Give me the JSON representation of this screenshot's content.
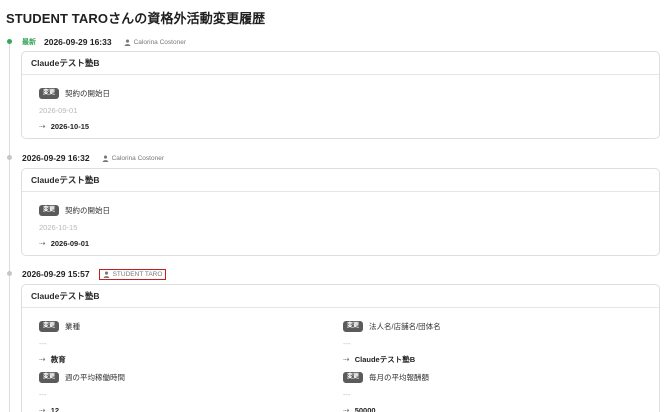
{
  "page": {
    "title": "STUDENT TAROさんの資格外活動変更履歴"
  },
  "common": {
    "latest_badge": "最新",
    "change_tag": "変更",
    "arrow": "⇢"
  },
  "entries": [
    {
      "timestamp": "2026-09-29 16:33",
      "user": "Calorina Costoner",
      "card_title": "Claudeテスト塾B",
      "changes": [
        {
          "field": "契約の開始日",
          "old": "2026-09-01",
          "new": "2026-10-15"
        }
      ]
    },
    {
      "timestamp": "2026-09-29 16:32",
      "user": "Calorina Costoner",
      "card_title": "Claudeテスト塾B",
      "changes": [
        {
          "field": "契約の開始日",
          "old": "2026-10-15",
          "new": "2026-09-01"
        }
      ]
    },
    {
      "timestamp": "2026-09-29 15:57",
      "user": "STUDENT TARO",
      "card_title": "Claudeテスト塾B",
      "changes": [
        {
          "field": "業種",
          "old": "---",
          "new": "教育"
        },
        {
          "field": "法人名/店舗名/団体名",
          "old": "---",
          "new": "Claudeテスト塾B"
        },
        {
          "field": "週の平均稼働時間",
          "old": "---",
          "new": "12"
        },
        {
          "field": "毎月の平均報酬額",
          "old": "---",
          "new": "50000"
        }
      ]
    }
  ]
}
